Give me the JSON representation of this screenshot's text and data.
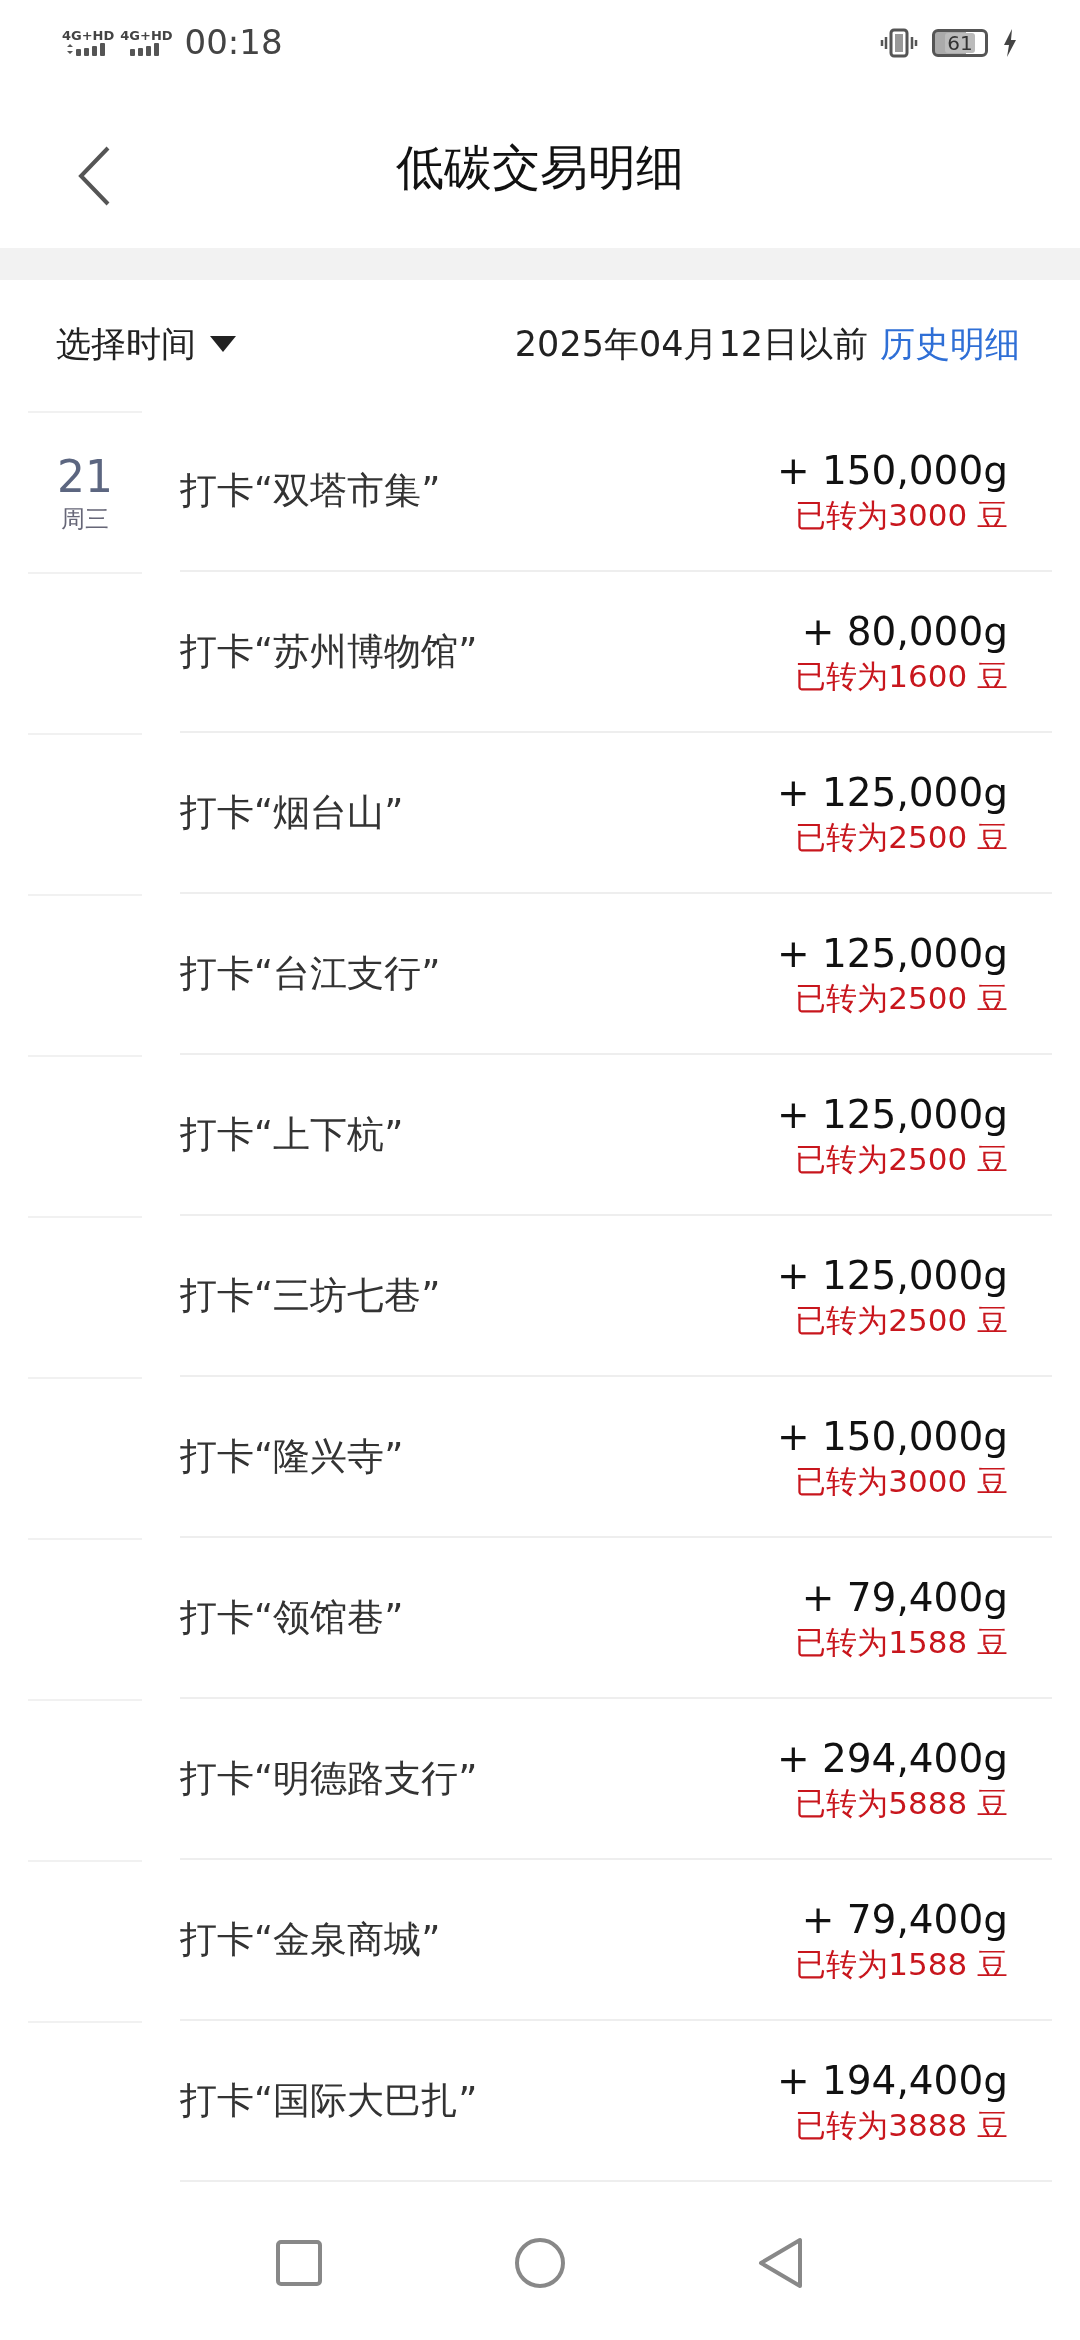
{
  "status_bar": {
    "network_1": "4G+HD",
    "network_2": "4G+HD",
    "time": "00:18",
    "battery": "61"
  },
  "header": {
    "title": "低碳交易明细"
  },
  "filter": {
    "label": "选择时间",
    "date_text": "2025年04月12日以前",
    "history_link": "历史明细"
  },
  "transactions": [
    {
      "day": "21",
      "weekday": "周三",
      "title": "打卡“双塔市集”",
      "amount": "+ 150,000g",
      "converted": "已转为3000 豆"
    },
    {
      "title": "打卡“苏州博物馆”",
      "amount": "+ 80,000g",
      "converted": "已转为1600 豆"
    },
    {
      "title": "打卡“烟台山”",
      "amount": "+ 125,000g",
      "converted": "已转为2500 豆"
    },
    {
      "title": "打卡“台江支行”",
      "amount": "+ 125,000g",
      "converted": "已转为2500 豆"
    },
    {
      "title": "打卡“上下杭”",
      "amount": "+ 125,000g",
      "converted": "已转为2500 豆"
    },
    {
      "title": "打卡“三坊七巷”",
      "amount": "+ 125,000g",
      "converted": "已转为2500 豆"
    },
    {
      "title": "打卡“隆兴寺”",
      "amount": "+ 150,000g",
      "converted": "已转为3000 豆"
    },
    {
      "title": "打卡“领馆巷”",
      "amount": "+ 79,400g",
      "converted": "已转为1588 豆"
    },
    {
      "title": "打卡“明德路支行”",
      "amount": "+ 294,400g",
      "converted": "已转为5888 豆"
    },
    {
      "title": "打卡“金泉商城”",
      "amount": "+ 79,400g",
      "converted": "已转为1588 豆"
    },
    {
      "title": "打卡“国际大巴扎”",
      "amount": "+ 194,400g",
      "converted": "已转为3888 豆"
    }
  ]
}
